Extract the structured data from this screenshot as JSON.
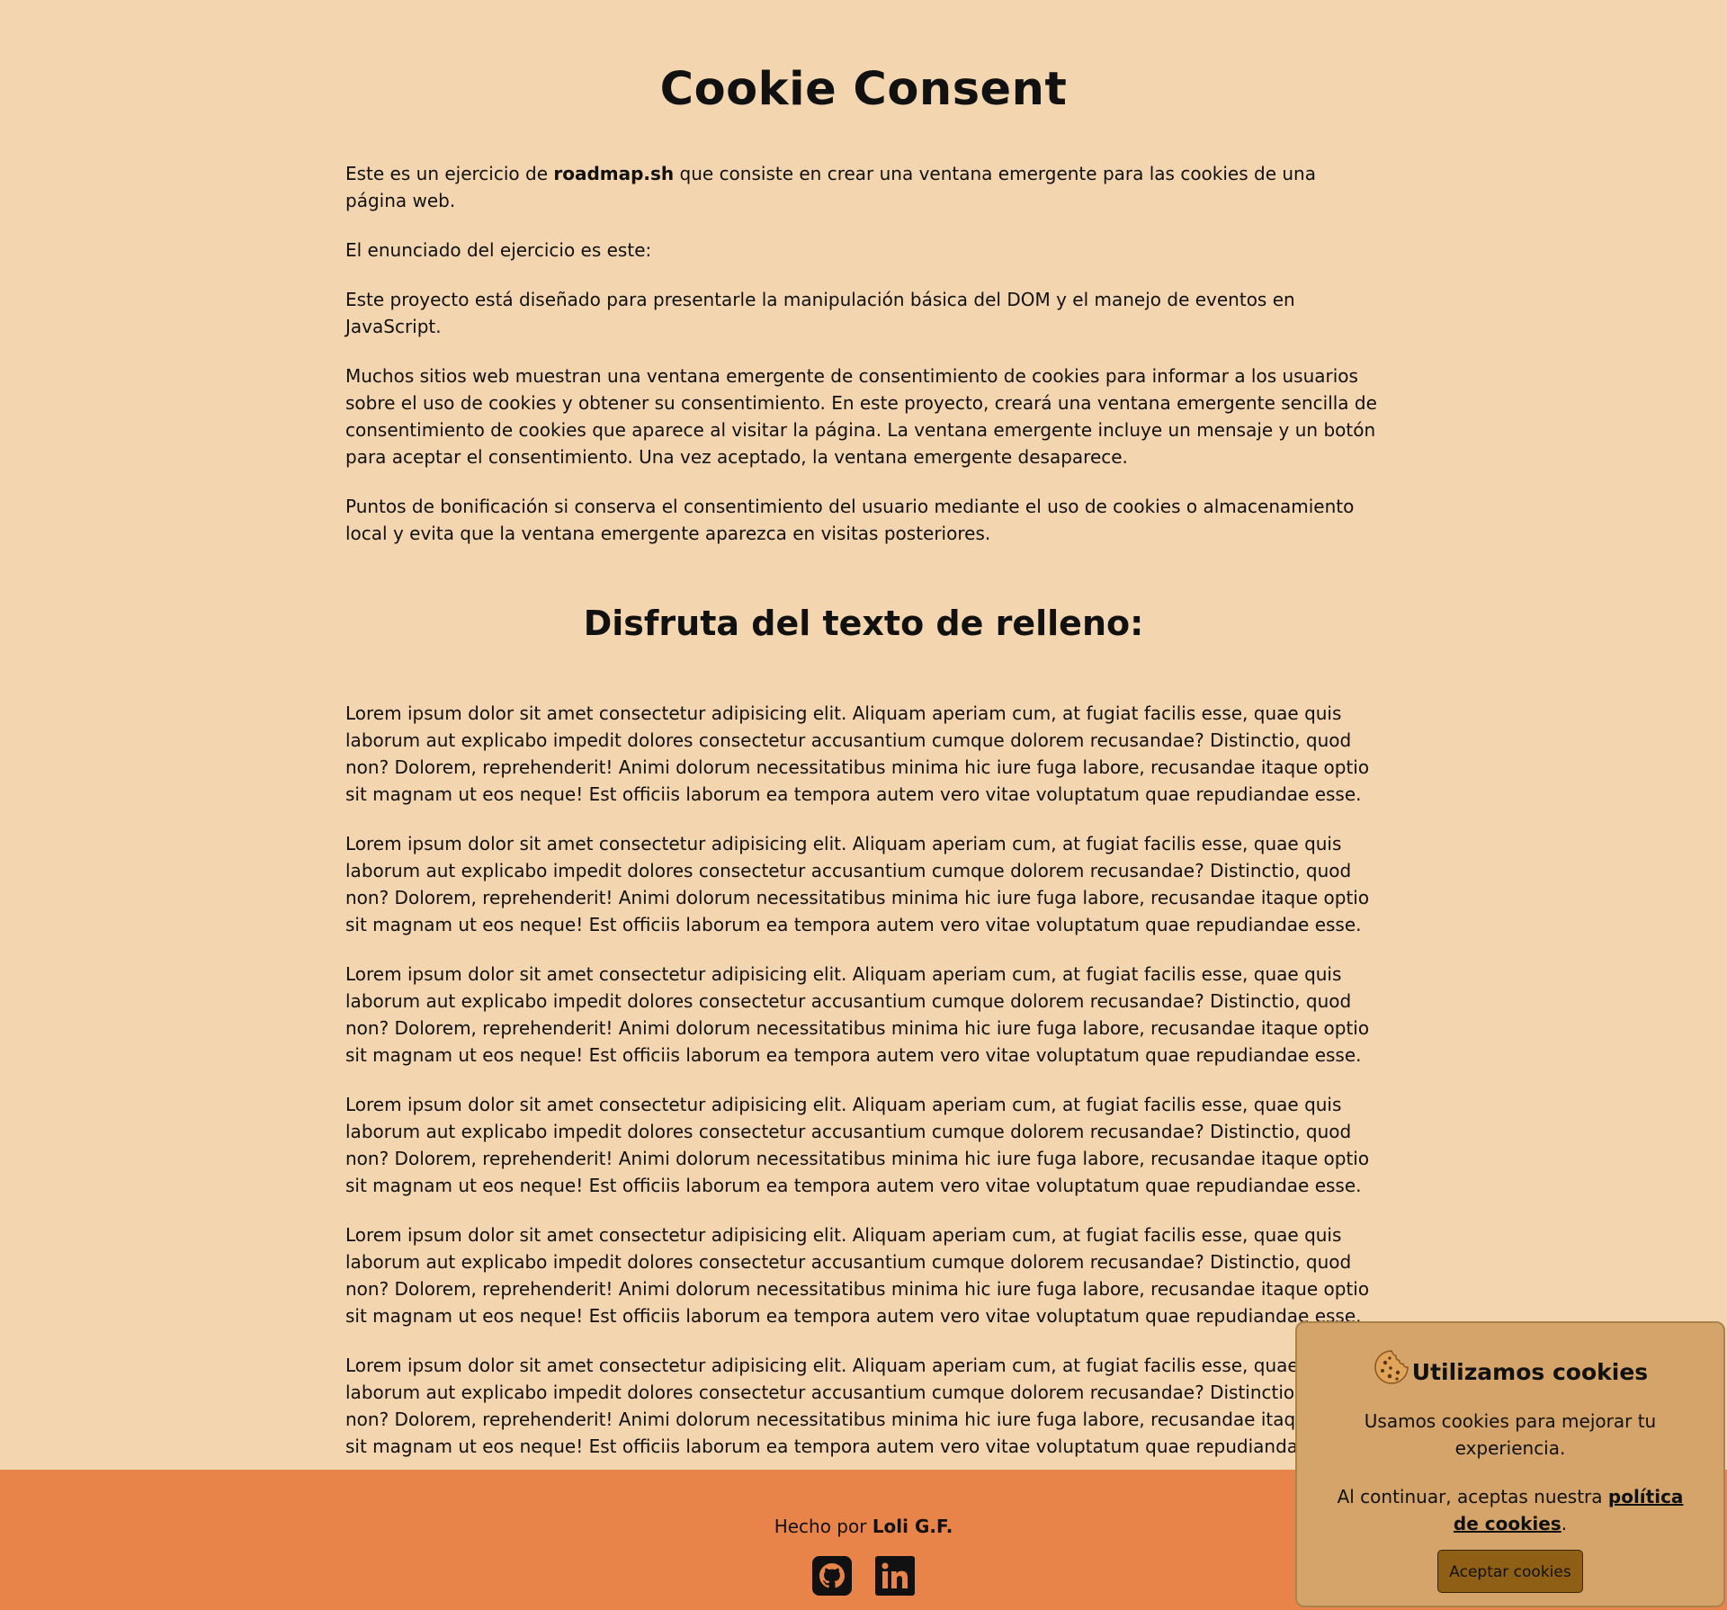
{
  "page": {
    "title": "Cookie Consent",
    "intro": {
      "p1_before": "Este es un ejercicio de ",
      "p1_bold": "roadmap.sh",
      "p1_after": " que consiste en crear una ventana emergente para las cookies de una página web.",
      "p2": "El enunciado del ejercicio es este:",
      "p3": "Este proyecto está diseñado para presentarle la manipulación básica del DOM y el manejo de eventos en JavaScript.",
      "p4": "Muchos sitios web muestran una ventana emergente de consentimiento de cookies para informar a los usuarios sobre el uso de cookies y obtener su consentimiento. En este proyecto, creará una ventana emergente sencilla de consentimiento de cookies que aparece al visitar la página. La ventana emergente incluye un mensaje y un botón para aceptar el consentimiento. Una vez aceptado, la ventana emergente desaparece.",
      "p5": "Puntos de bonificación si conserva el consentimiento del usuario mediante el uso de cookies o almacenamiento local y evita que la ventana emergente aparezca en visitas posteriores."
    },
    "filler_heading": "Disfruta del texto de relleno:",
    "lorem": [
      "Lorem ipsum dolor sit amet consectetur adipisicing elit. Aliquam aperiam cum, at fugiat facilis esse, quae quis laborum aut explicabo impedit dolores consectetur accusantium cumque dolorem recusandae? Distinctio, quod non? Dolorem, reprehenderit! Animi dolorum necessitatibus minima hic iure fuga labore, recusandae itaque optio sit magnam ut eos neque! Est officiis laborum ea tempora autem vero vitae voluptatum quae repudiandae esse.",
      "Lorem ipsum dolor sit amet consectetur adipisicing elit. Aliquam aperiam cum, at fugiat facilis esse, quae quis laborum aut explicabo impedit dolores consectetur accusantium cumque dolorem recusandae? Distinctio, quod non? Dolorem, reprehenderit! Animi dolorum necessitatibus minima hic iure fuga labore, recusandae itaque optio sit magnam ut eos neque! Est officiis laborum ea tempora autem vero vitae voluptatum quae repudiandae esse.",
      "Lorem ipsum dolor sit amet consectetur adipisicing elit. Aliquam aperiam cum, at fugiat facilis esse, quae quis laborum aut explicabo impedit dolores consectetur accusantium cumque dolorem recusandae? Distinctio, quod non? Dolorem, reprehenderit! Animi dolorum necessitatibus minima hic iure fuga labore, recusandae itaque optio sit magnam ut eos neque! Est officiis laborum ea tempora autem vero vitae voluptatum quae repudiandae esse.",
      "Lorem ipsum dolor sit amet consectetur adipisicing elit. Aliquam aperiam cum, at fugiat facilis esse, quae quis laborum aut explicabo impedit dolores consectetur accusantium cumque dolorem recusandae? Distinctio, quod non? Dolorem, reprehenderit! Animi dolorum necessitatibus minima hic iure fuga labore, recusandae itaque optio sit magnam ut eos neque! Est officiis laborum ea tempora autem vero vitae voluptatum quae repudiandae esse.",
      "Lorem ipsum dolor sit amet consectetur adipisicing elit. Aliquam aperiam cum, at fugiat facilis esse, quae quis laborum aut explicabo impedit dolores consectetur accusantium cumque dolorem recusandae? Distinctio, quod non? Dolorem, reprehenderit! Animi dolorum necessitatibus minima hic iure fuga labore, recusandae itaque optio sit magnam ut eos neque! Est officiis laborum ea tempora autem vero vitae voluptatum quae repudiandae esse.",
      "Lorem ipsum dolor sit amet consectetur adipisicing elit. Aliquam aperiam cum, at fugiat facilis esse, quae quis laborum aut explicabo impedit dolores consectetur accusantium cumque dolorem recusandae? Distinctio, quod non? Dolorem, reprehenderit! Animi dolorum necessitatibus minima hic iure fuga labore, recusandae itaque optio sit magnam ut eos neque! Est officiis laborum ea tempora autem vero vitae voluptatum quae repudiandae esse."
    ]
  },
  "footer": {
    "made_by_prefix": "Hecho por ",
    "author": "Loli G.F.",
    "icons": [
      "github-icon",
      "linkedin-icon"
    ]
  },
  "cookie_popup": {
    "icon": "cookie-icon",
    "title": "Utilizamos cookies",
    "message": "Usamos cookies para mejorar tu experiencia.",
    "continue_prefix": "Al continuar, aceptas nuestra ",
    "policy_link": "política de cookies",
    "continue_suffix": ".",
    "accept_label": "Aceptar cookies"
  },
  "colors": {
    "background": "#f3d5b0",
    "footer": "#e8844a",
    "popup": "#d4a46a",
    "button": "#8e5f15"
  }
}
